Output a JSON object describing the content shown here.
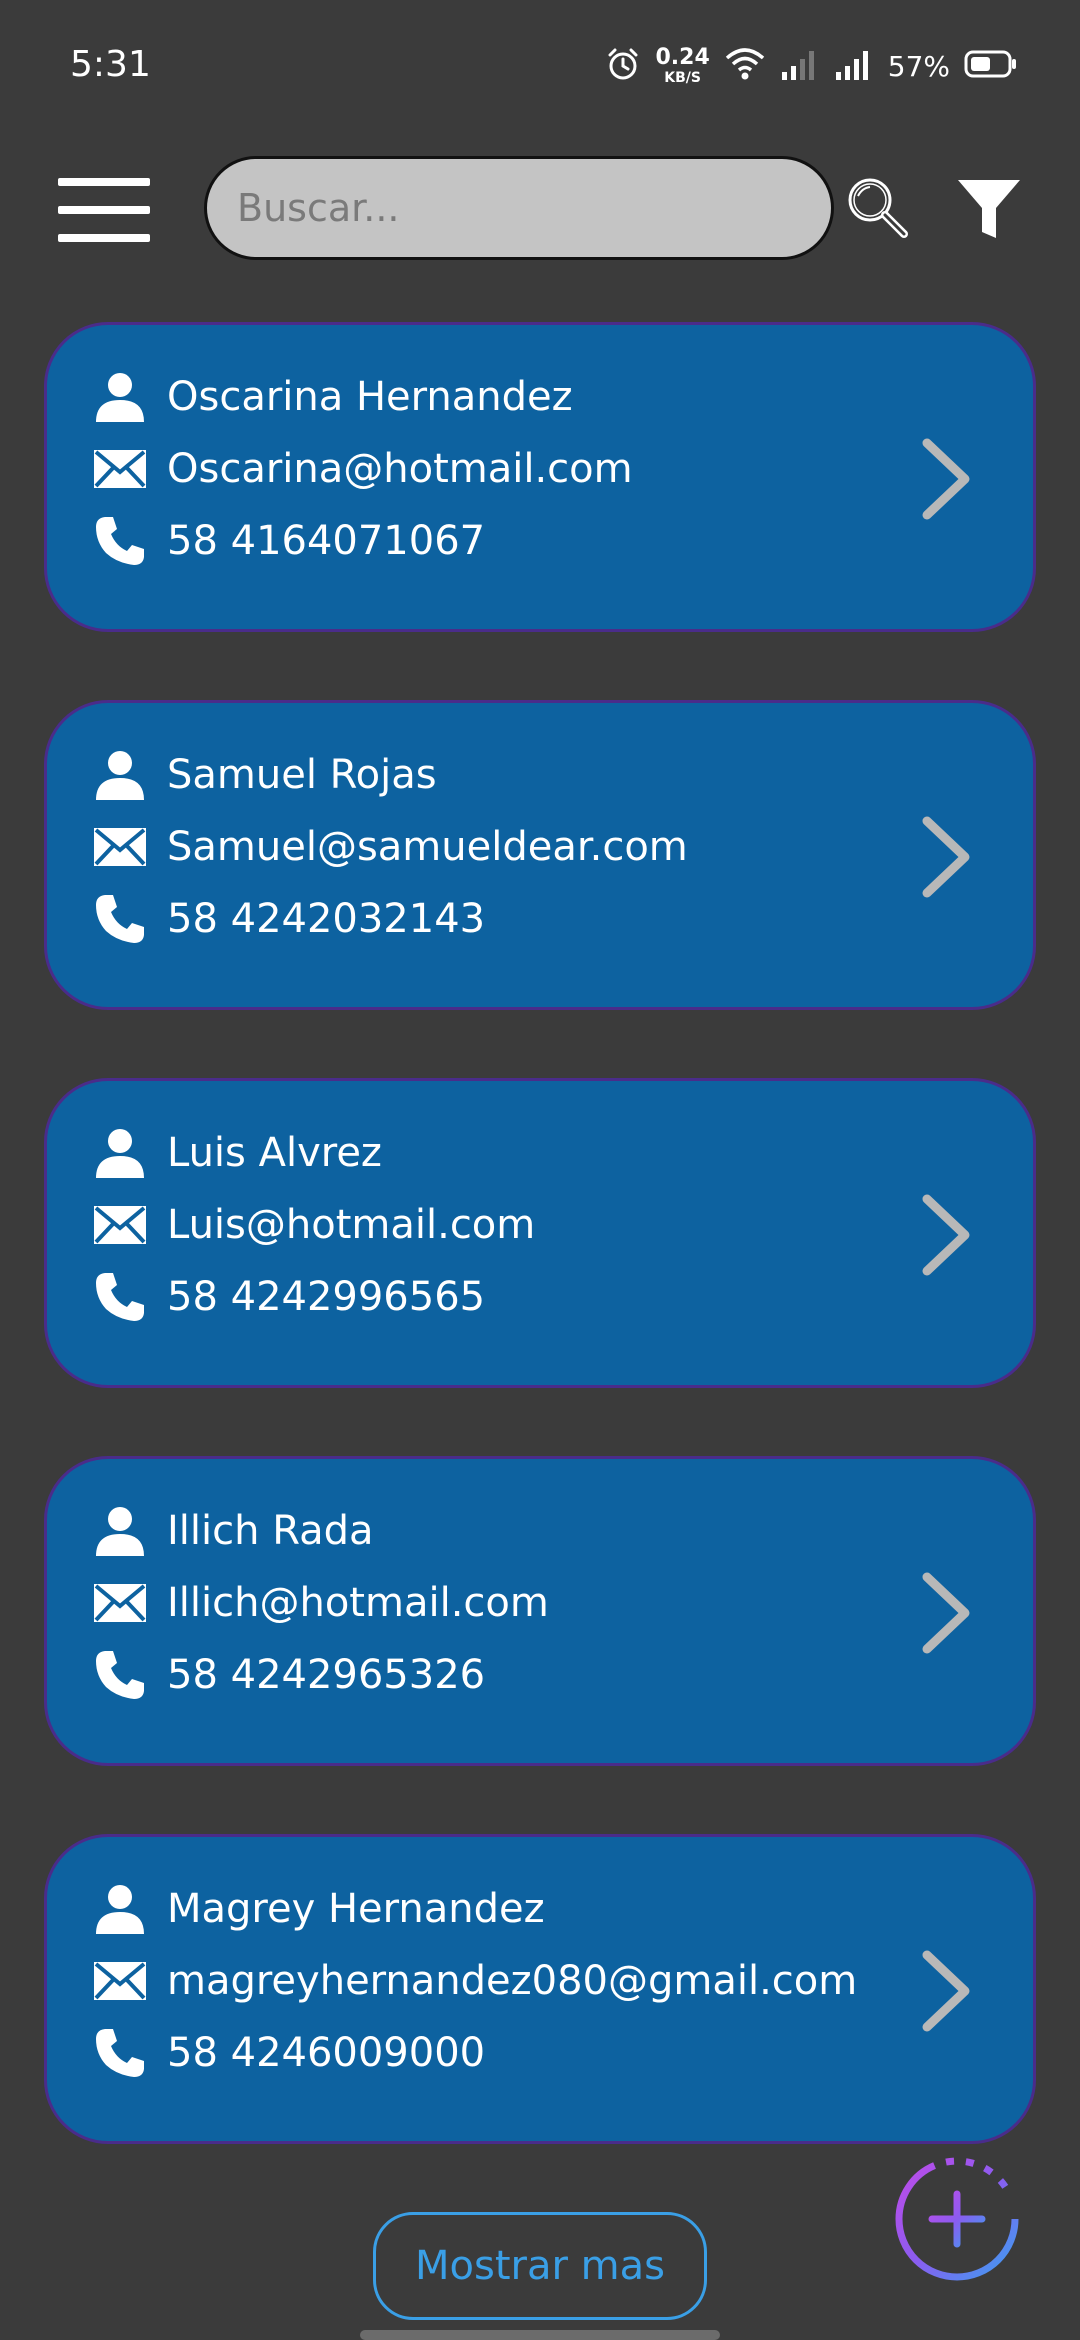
{
  "status_bar": {
    "time": "5:31",
    "net_speed_value": "0.24",
    "net_speed_unit": "KB/S",
    "battery": "57%"
  },
  "toolbar": {
    "search_placeholder": "Buscar...",
    "icons": [
      "menu-icon",
      "search-icon",
      "filter-icon"
    ]
  },
  "contacts": [
    {
      "name": "Oscarina Hernandez",
      "email": "Oscarina@hotmail.com",
      "phone": "58 4164071067"
    },
    {
      "name": "Samuel Rojas",
      "email": "Samuel@samueldear.com",
      "phone": "58 4242032143"
    },
    {
      "name": "Luis Alvrez",
      "email": "Luis@hotmail.com",
      "phone": "58 4242996565"
    },
    {
      "name": "Illich Rada",
      "email": "Illich@hotmail.com",
      "phone": "58 4242965326"
    },
    {
      "name": "Magrey Hernandez",
      "email": "magreyhernandez080@gmail.com",
      "phone": "58 4246009000"
    }
  ],
  "footer": {
    "show_more_label": "Mostrar mas"
  },
  "colors": {
    "background": "#3b3b3b",
    "card": "#0d62a0",
    "card_border": "#4a2c8a",
    "accent": "#3a9fe6",
    "search_field": "#c4c4c4"
  }
}
